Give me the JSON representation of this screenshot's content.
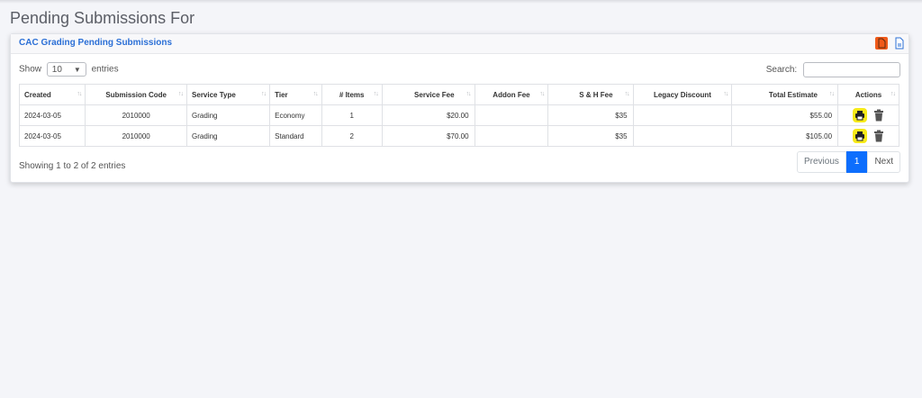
{
  "page": {
    "title": "Pending Submissions For"
  },
  "card": {
    "title": "CAC Grading Pending Submissions"
  },
  "controls": {
    "show_label": "Show",
    "page_size": "10",
    "entries_label": "entries",
    "search_label": "Search:"
  },
  "table": {
    "headers": [
      "Created",
      "Submission Code",
      "Service Type",
      "Tier",
      "# Items",
      "Service Fee",
      "Addon Fee",
      "S & H Fee",
      "Legacy Discount",
      "Total Estimate",
      "Actions"
    ],
    "rows": [
      {
        "created": "2024-03-05",
        "code": "2010000",
        "type": "Grading",
        "tier": "Economy",
        "items": "1",
        "service_fee": "$20.00",
        "addon_fee": "",
        "sh_fee": "$35",
        "legacy": "",
        "total": "$55.00"
      },
      {
        "created": "2024-03-05",
        "code": "2010000",
        "type": "Grading",
        "tier": "Standard",
        "items": "2",
        "service_fee": "$70.00",
        "addon_fee": "",
        "sh_fee": "$35",
        "legacy": "",
        "total": "$105.00"
      }
    ]
  },
  "footer": {
    "info": "Showing 1 to 2 of 2 entries",
    "previous": "Previous",
    "current_page": "1",
    "next": "Next"
  },
  "colors": {
    "accent": "#2b6fd6",
    "print_button": "#f7ea18",
    "pdf_icon": "#f05a1a",
    "page_active": "#0d6efd"
  },
  "icons": {
    "sort": "sort-icon",
    "print": "print-icon",
    "trash": "trash-icon",
    "pdf": "pdf-icon",
    "document": "document-icon",
    "chevron": "chevron-down-icon"
  }
}
